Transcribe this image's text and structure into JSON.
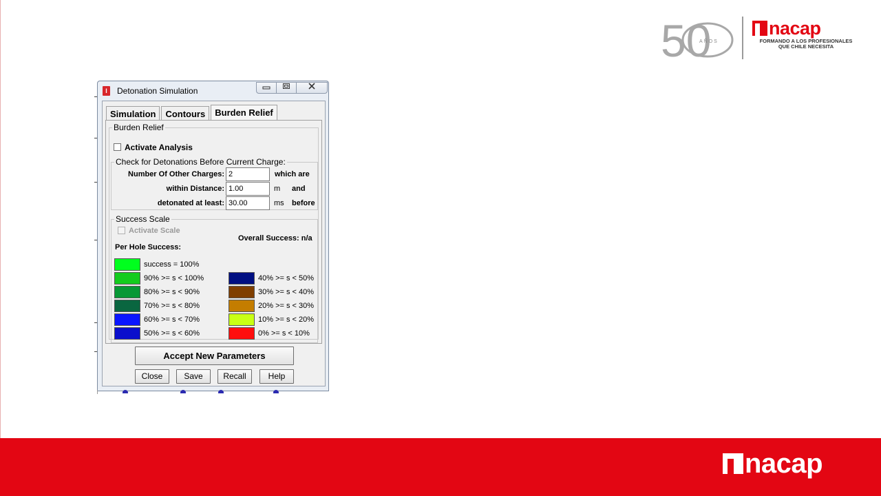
{
  "header": {
    "anniversary_number": "50",
    "anniversary_label": "AÑOS",
    "brand": "nacap",
    "tagline_line1": "FORMANDO A LOS PROFESIONALES",
    "tagline_line2": "QUE CHILE NECESITA"
  },
  "footer": {
    "brand": "nacap"
  },
  "window": {
    "title": "Detonation Simulation",
    "app_icon_glyph": "I",
    "tabs": [
      {
        "label": "Simulation",
        "active": false
      },
      {
        "label": "Contours",
        "active": false
      },
      {
        "label": "Burden Relief",
        "active": true
      }
    ],
    "burden": {
      "group_title": "Burden Relief",
      "activate_label": "Activate Analysis",
      "activate_checked": false,
      "check_group_title": "Check for Detonations Before Current Charge:",
      "fields": [
        {
          "label": "Number Of Other Charges:",
          "value": "2",
          "unit": "which are"
        },
        {
          "label": "within Distance:",
          "value": "1.00",
          "unit": "m",
          "suffix": "and"
        },
        {
          "label": "detonated at least:",
          "value": "30.00",
          "unit": "ms",
          "suffix": "before"
        }
      ]
    },
    "success": {
      "group_title": "Success Scale",
      "activate_label": "Activate Scale",
      "overall_label": "Overall Success: n/a",
      "per_hole_label": "Per Hole Success:",
      "left_scale": [
        {
          "label": "success = 100%",
          "color": "#00ff1e"
        },
        {
          "label": "90% >= s < 100%",
          "color": "#14cc1e"
        },
        {
          "label": "80% >= s < 90%",
          "color": "#079835"
        },
        {
          "label": "70% >= s < 80%",
          "color": "#0a6640"
        },
        {
          "label": "60% >= s < 70%",
          "color": "#0a16ff"
        },
        {
          "label": "50% >= s < 60%",
          "color": "#0a0fcc"
        }
      ],
      "right_scale": [
        {
          "label": "40% >= s < 50%",
          "color": "#000f82"
        },
        {
          "label": "30% >= s < 40%",
          "color": "#7f3e00"
        },
        {
          "label": "20% >= s < 30%",
          "color": "#c47d00"
        },
        {
          "label": "10% >= s < 20%",
          "color": "#c9ff14"
        },
        {
          "label": "0% >= s < 10%",
          "color": "#ff0e0e"
        }
      ]
    },
    "buttons": {
      "accept": "Accept New Parameters",
      "close": "Close",
      "save": "Save",
      "recall": "Recall",
      "help": "Help"
    }
  },
  "colors": {
    "brand_red": "#e30613"
  }
}
